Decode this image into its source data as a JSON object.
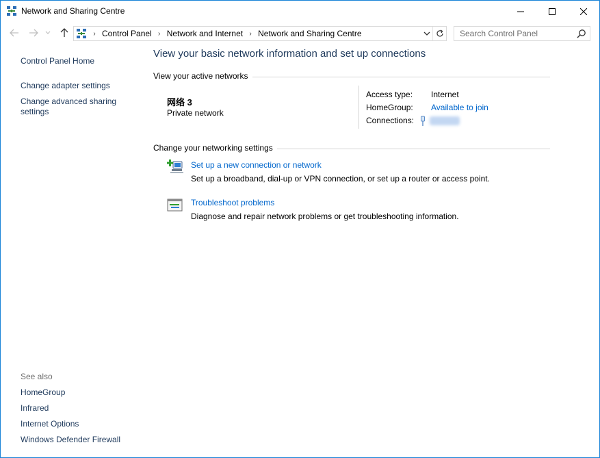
{
  "window": {
    "title": "Network and Sharing Centre",
    "colors": {
      "border": "#1883d7",
      "link": "#0066cc",
      "nav_link": "#1e395b"
    }
  },
  "navbar": {
    "breadcrumbs": [
      "Control Panel",
      "Network and Internet",
      "Network and Sharing Centre"
    ],
    "search_placeholder": "Search Control Panel",
    "icons": [
      "back-arrow-icon",
      "forward-arrow-icon",
      "recent-dropdown-icon",
      "up-arrow-icon",
      "network-icon",
      "dropdown-icon",
      "refresh-icon",
      "search-icon"
    ]
  },
  "left_pane": {
    "links": [
      "Control Panel Home",
      "Change adapter settings",
      "Change advanced sharing settings"
    ],
    "see_also_label": "See also",
    "see_also_links": [
      "HomeGroup",
      "Infrared",
      "Internet Options",
      "Windows Defender Firewall"
    ]
  },
  "main": {
    "title": "View your basic network information and set up connections",
    "active_networks_label": "View your active networks",
    "network": {
      "name": "网络 3",
      "type": "Private network",
      "access_type_label": "Access type:",
      "access_type_value": "Internet",
      "homegroup_label": "HomeGroup:",
      "homegroup_value": "Available to join",
      "connections_label": "Connections:"
    },
    "change_settings_label": "Change your networking settings",
    "tasks": [
      {
        "link": "Set up a new connection or network",
        "description": "Set up a broadband, dial-up or VPN connection, or set up a router or access point.",
        "icon": "new-connection-icon"
      },
      {
        "link": "Troubleshoot problems",
        "description": "Diagnose and repair network problems or get troubleshooting information.",
        "icon": "troubleshoot-icon"
      }
    ]
  }
}
